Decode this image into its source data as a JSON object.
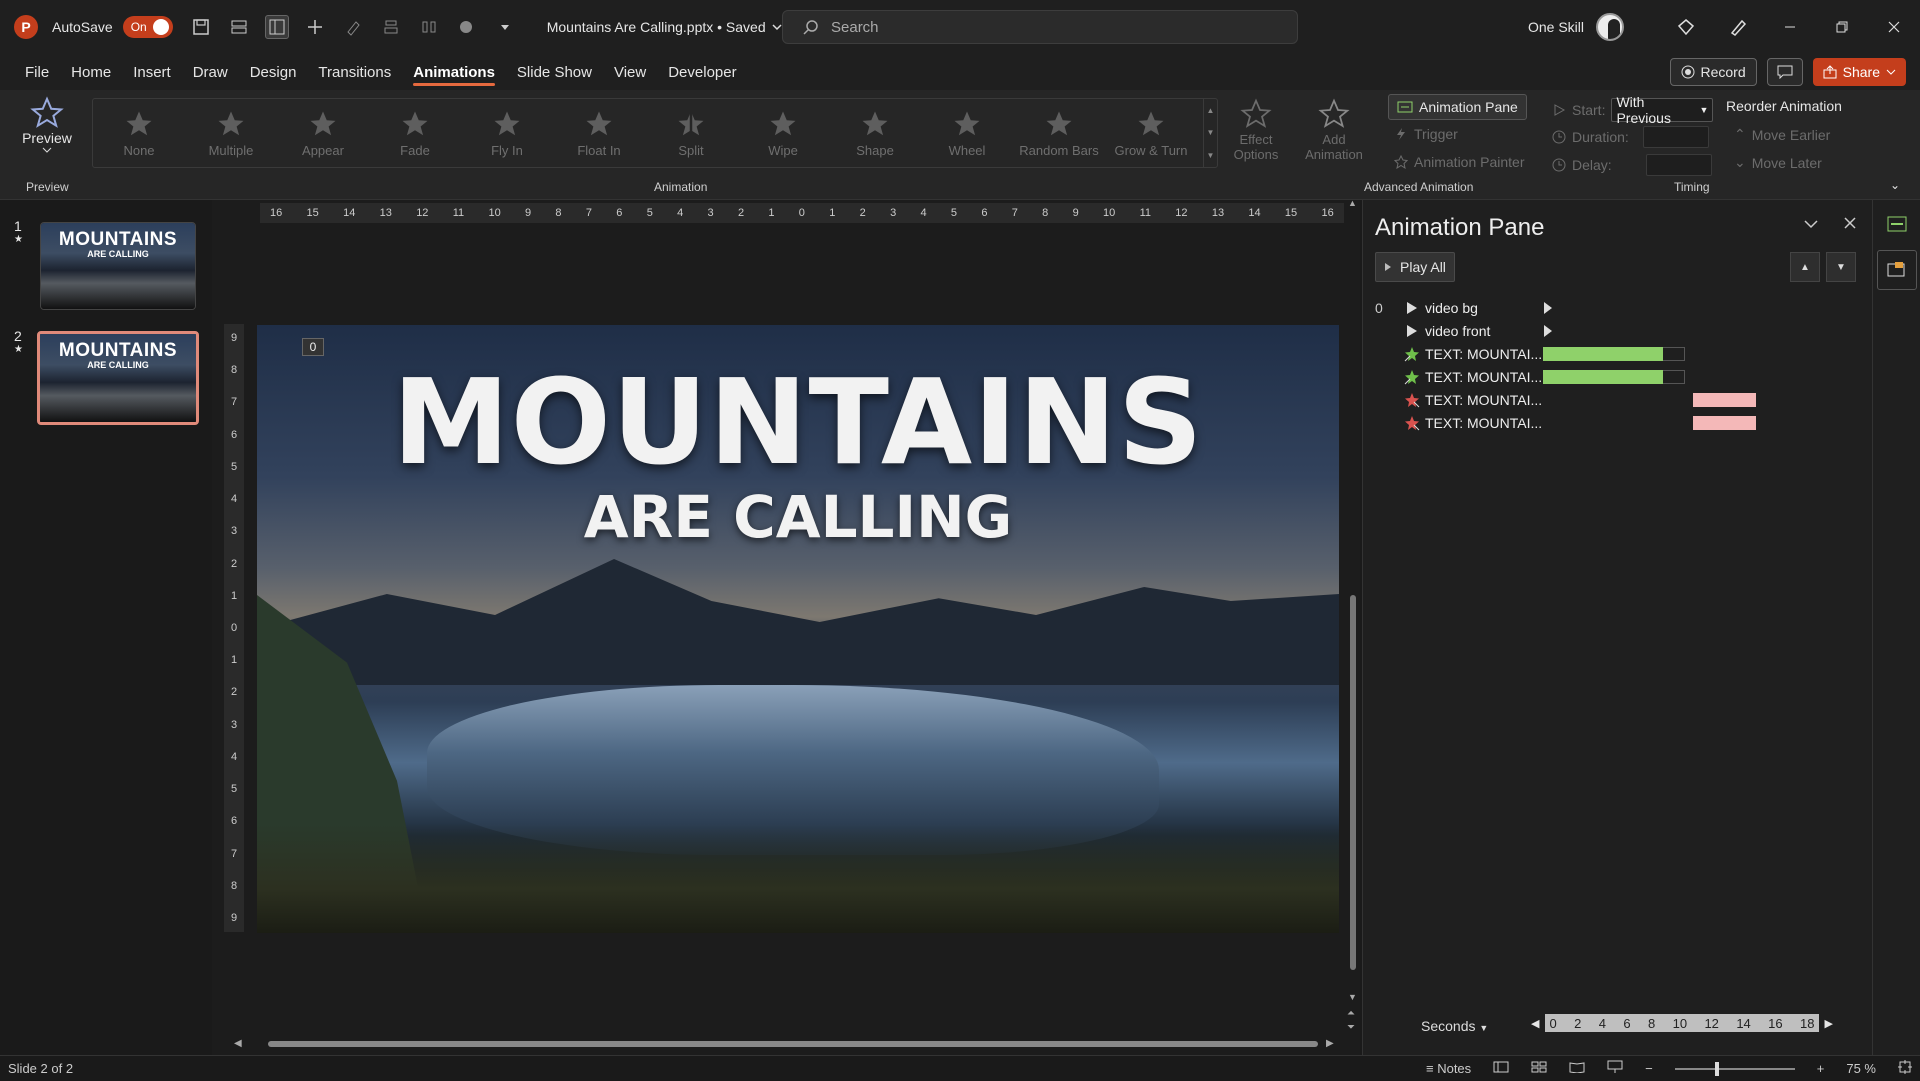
{
  "app": {
    "logo_letter": "P",
    "autosave_label": "AutoSave",
    "autosave_state": "On",
    "doc_title": "Mountains Are Calling.pptx • Saved"
  },
  "search": {
    "placeholder": "Search"
  },
  "account": {
    "name": "One Skill"
  },
  "menu": {
    "tabs": [
      "File",
      "Home",
      "Insert",
      "Draw",
      "Design",
      "Transitions",
      "Animations",
      "Slide Show",
      "View",
      "Developer"
    ],
    "active": "Animations",
    "record": "Record",
    "share": "Share"
  },
  "ribbon": {
    "preview": "Preview",
    "preview_group": "Preview",
    "animation_group": "Animation",
    "advanced_group": "Advanced Animation",
    "timing_group": "Timing",
    "animations": [
      "None",
      "Multiple",
      "Appear",
      "Fade",
      "Fly In",
      "Float In",
      "Split",
      "Wipe",
      "Shape",
      "Wheel",
      "Random Bars",
      "Grow & Turn"
    ],
    "effect_options": "Effect Options",
    "add_animation": "Add Animation",
    "animation_pane": "Animation Pane",
    "trigger": "Trigger",
    "animation_painter": "Animation Painter",
    "start_label": "Start:",
    "start_value": "With Previous",
    "duration_label": "Duration:",
    "delay_label": "Delay:",
    "reorder": "Reorder Animation",
    "move_earlier": "Move Earlier",
    "move_later": "Move Later"
  },
  "slides": [
    {
      "number": "1",
      "title": "MOUNTAINS",
      "subtitle": "ARE CALLING"
    },
    {
      "number": "2",
      "title": "MOUNTAINS",
      "subtitle": "ARE CALLING"
    }
  ],
  "rulers": {
    "horizontal": [
      "16",
      "15",
      "14",
      "13",
      "12",
      "11",
      "10",
      "9",
      "8",
      "7",
      "6",
      "5",
      "4",
      "3",
      "2",
      "1",
      "0",
      "1",
      "2",
      "3",
      "4",
      "5",
      "6",
      "7",
      "8",
      "9",
      "10",
      "11",
      "12",
      "13",
      "14",
      "15",
      "16"
    ],
    "vertical": [
      "9",
      "8",
      "7",
      "6",
      "5",
      "4",
      "3",
      "2",
      "1",
      "0",
      "1",
      "2",
      "3",
      "4",
      "5",
      "6",
      "7",
      "8",
      "9"
    ]
  },
  "slide": {
    "title": "MOUNTAINS",
    "subtitle": "ARE CALLING",
    "anim_badge": "0"
  },
  "pane": {
    "title": "Animation Pane",
    "play_all": "Play All",
    "items": [
      {
        "num": "0",
        "name": "video bg",
        "type": "play"
      },
      {
        "num": "",
        "name": "video front",
        "type": "play"
      },
      {
        "num": "",
        "name": "TEXT: MOUNTAI...",
        "type": "entrance",
        "bar_start": 0,
        "bar_end": 0.48,
        "bar_color": "#8fd16a"
      },
      {
        "num": "",
        "name": "TEXT: MOUNTAI...",
        "type": "entrance",
        "bar_start": 0,
        "bar_end": 0.48,
        "bar_color": "#8fd16a"
      },
      {
        "num": "",
        "name": "TEXT: MOUNTAI...",
        "type": "exit",
        "bar_start": 0.6,
        "bar_end": 0.85,
        "bar_color": "#f4b8b8"
      },
      {
        "num": "",
        "name": "TEXT: MOUNTAI...",
        "type": "exit",
        "bar_start": 0.6,
        "bar_end": 0.85,
        "bar_color": "#f4b8b8"
      }
    ],
    "seconds_label": "Seconds",
    "scale": [
      "0",
      "2",
      "4",
      "6",
      "8",
      "10",
      "12",
      "14",
      "16",
      "18"
    ]
  },
  "status": {
    "slide_info": "Slide 2 of 2",
    "notes": "Notes",
    "zoom": "75 %"
  },
  "colors": {
    "accent": "#c43e1c",
    "tab_underline": "#e5693e",
    "green_bar": "#8fd16a",
    "pink_bar": "#f4b8b8"
  }
}
